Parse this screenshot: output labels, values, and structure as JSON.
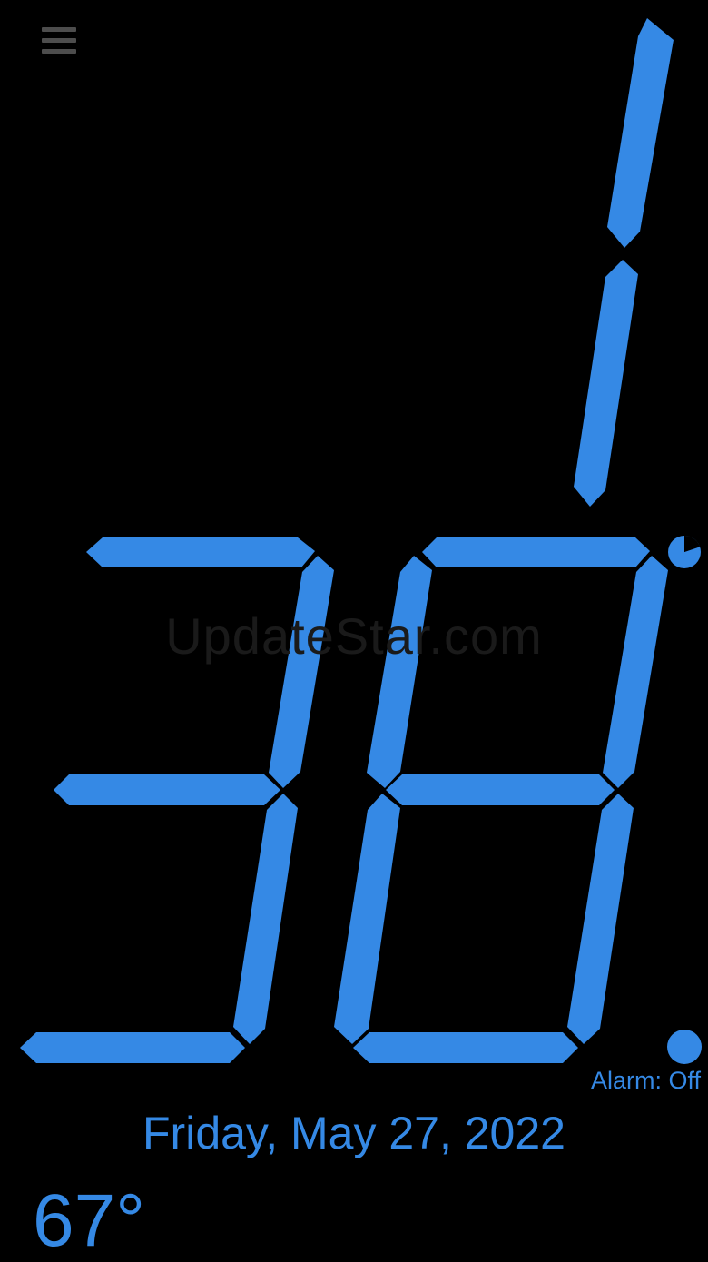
{
  "app": {
    "accent_color": "#3589e5",
    "background_color": "#000000"
  },
  "menu": {
    "icon": "hamburger-menu-icon"
  },
  "clock": {
    "hour": "1",
    "minutes": "38",
    "seconds_pie_icon": "seconds-progress-icon",
    "pm_indicator_icon": "pm-dot-icon"
  },
  "watermark": "UpdateStar.com",
  "alarm": {
    "text": "Alarm: Off"
  },
  "date": {
    "text": "Friday, May 27, 2022"
  },
  "weather": {
    "temperature": "67°"
  }
}
